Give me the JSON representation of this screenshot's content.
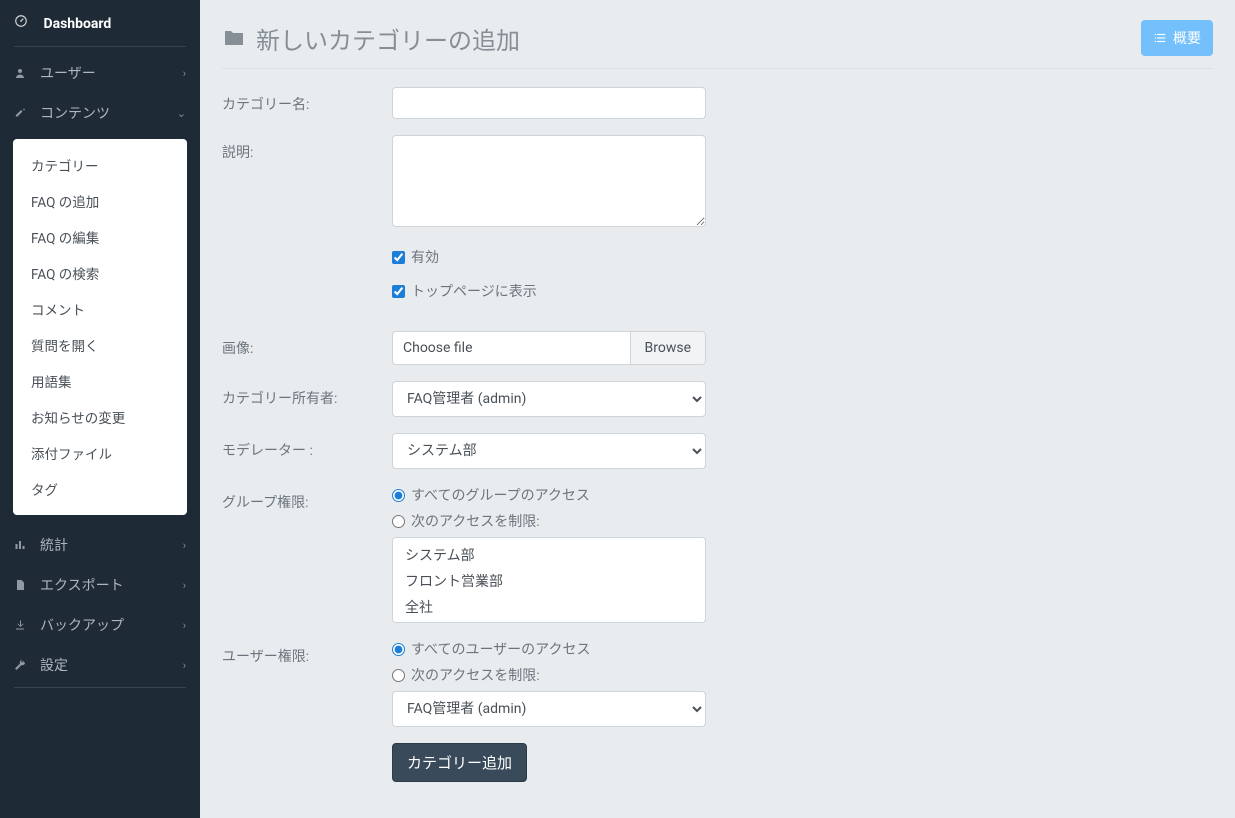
{
  "sidebar": {
    "dashboard": "Dashboard",
    "users": "ユーザー",
    "contents": "コンテンツ",
    "submenu": [
      "カテゴリー",
      "FAQ の追加",
      "FAQ の編集",
      "FAQ の検索",
      "コメント",
      "質問を開く",
      "用語集",
      "お知らせの変更",
      "添付ファイル",
      "タグ"
    ],
    "stats": "統計",
    "export": "エクスポート",
    "backup": "バックアップ",
    "settings": "設定"
  },
  "header": {
    "title": "新しいカテゴリーの追加",
    "overview_button": "概要"
  },
  "form": {
    "category_name_label": "カテゴリー名:",
    "category_name_value": "",
    "description_label": "説明:",
    "description_value": "",
    "enabled_label": "有効",
    "enabled_checked": true,
    "show_top_label": "トップページに表示",
    "show_top_checked": true,
    "image_label": "画像:",
    "file_placeholder": "Choose file",
    "file_browse": "Browse",
    "owner_label": "カテゴリー所有者:",
    "owner_value": "FAQ管理者 (admin)",
    "moderator_label": "モデレーター :",
    "moderator_value": "システム部",
    "group_perm_label": "グループ権限:",
    "group_perm_all": "すべてのグループのアクセス",
    "group_perm_restrict": "次のアクセスを制限:",
    "group_options": [
      "システム部",
      "フロント営業部",
      "全社"
    ],
    "user_perm_label": "ユーザー権限:",
    "user_perm_all": "すべてのユーザーのアクセス",
    "user_perm_restrict": "次のアクセスを制限:",
    "user_select_value": "FAQ管理者 (admin)",
    "submit_label": "カテゴリー追加"
  }
}
